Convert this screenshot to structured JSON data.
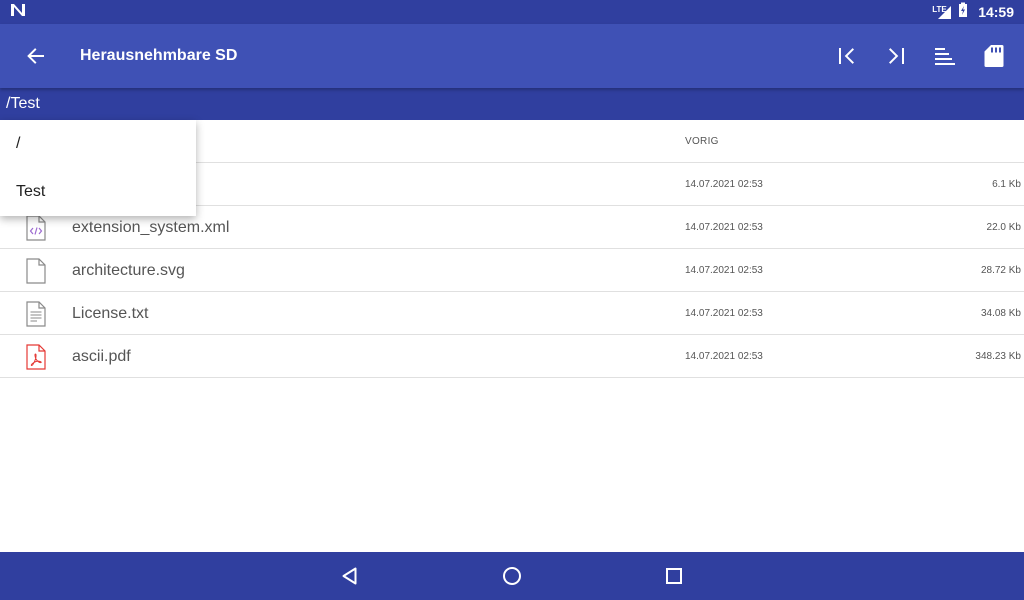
{
  "status": {
    "time": "14:59",
    "network": "LTE"
  },
  "toolbar": {
    "title": "Herausnehmbare SD"
  },
  "path": "/Test",
  "dropdown": {
    "items": [
      "/",
      "Test"
    ]
  },
  "list": {
    "header_date": "VORIG",
    "files": [
      {
        "name": "",
        "date": "14.07.2021 02:53",
        "size": "6.1 Kb",
        "icon": "file-icon"
      },
      {
        "name": "extension_system.xml",
        "date": "14.07.2021 02:53",
        "size": "22.0 Kb",
        "icon": "code-file-icon"
      },
      {
        "name": "architecture.svg",
        "date": "14.07.2021 02:53",
        "size": "28.72 Kb",
        "icon": "file-icon"
      },
      {
        "name": "License.txt",
        "date": "14.07.2021 02:53",
        "size": "34.08 Kb",
        "icon": "text-file-icon"
      },
      {
        "name": "ascii.pdf",
        "date": "14.07.2021 02:53",
        "size": "348.23 Kb",
        "icon": "pdf-file-icon"
      }
    ]
  },
  "colors": {
    "primary": "#3f51b5",
    "primary_dark": "#303f9f",
    "code_icon": "#9c6ad0",
    "pdf_icon": "#e53935"
  }
}
